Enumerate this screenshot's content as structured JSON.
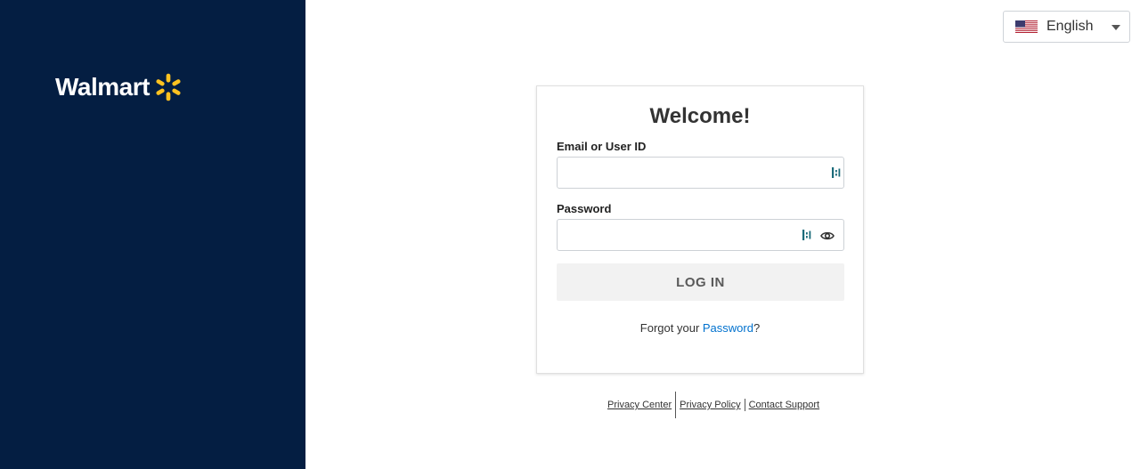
{
  "brand": {
    "name": "Walmart",
    "logo_icon": "spark-icon",
    "panel_color": "#041e42",
    "spark_color": "#ffc220"
  },
  "language": {
    "selected": "English",
    "flag_icon": "us-flag-icon"
  },
  "login": {
    "title": "Welcome!",
    "email_label": "Email or User ID",
    "email_value": "",
    "password_label": "Password",
    "password_value": "",
    "password_toggle_icon": "eye-icon",
    "field_helper_icon": "password-manager-icon",
    "submit_label": "LOG IN",
    "forgot_prefix": "Forgot your ",
    "forgot_link": "Password",
    "forgot_suffix": "?",
    "link_color": "#0071ce"
  },
  "footer": {
    "links": [
      "Privacy Center",
      "Privacy Policy",
      "Contact Support"
    ]
  }
}
